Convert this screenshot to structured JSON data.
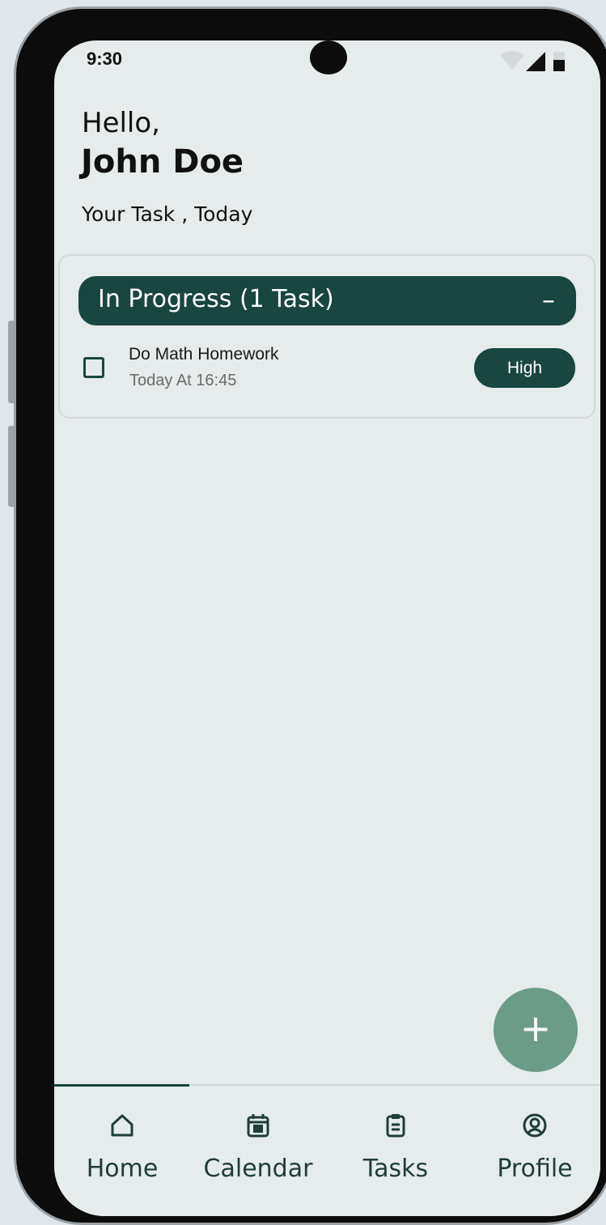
{
  "status_bar": {
    "time": "9:30",
    "icons": [
      "wifi-icon",
      "signal-icon",
      "battery-icon"
    ]
  },
  "header": {
    "greeting": "Hello,",
    "username": "John Doe",
    "subtitle": "Your Task , Today"
  },
  "task_group": {
    "title": "In Progress (1 Task)",
    "collapse_symbol": "–",
    "tasks": [
      {
        "title": "Do Math Homework",
        "due": "Today At 16:45",
        "priority": "High",
        "checked": false
      }
    ]
  },
  "fab": {
    "symbol": "+",
    "icon": "add-icon"
  },
  "bottom_nav": {
    "active": "Home",
    "items": [
      {
        "label": "Home",
        "icon": "home-icon"
      },
      {
        "label": "Calendar",
        "icon": "calendar-icon"
      },
      {
        "label": "Tasks",
        "icon": "clipboard-icon"
      },
      {
        "label": "Profile",
        "icon": "profile-icon"
      }
    ]
  },
  "colors": {
    "primary": "#184640",
    "fab": "#6b9c88",
    "background": "#e6ebec",
    "text": "#111111",
    "muted_text": "#6b6b6b"
  }
}
